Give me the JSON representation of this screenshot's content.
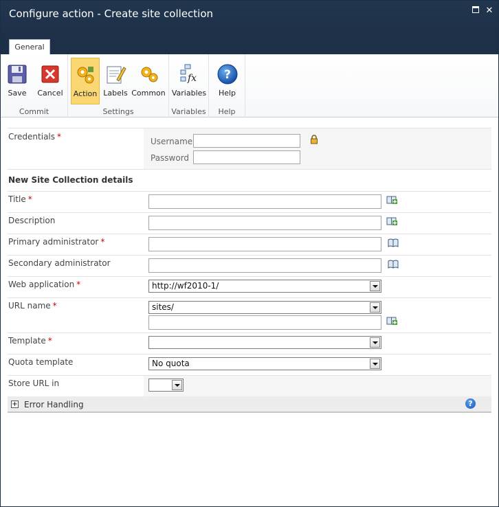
{
  "window": {
    "title": "Configure action - Create site collection"
  },
  "ribbon": {
    "tab": "General",
    "groups": {
      "commit": "Commit",
      "settings": "Settings",
      "variables": "Variables",
      "help": "Help"
    },
    "buttons": {
      "save": "Save",
      "cancel": "Cancel",
      "action": "Action",
      "labels": "Labels",
      "common": "Common",
      "variables": "Variables",
      "help": "Help"
    }
  },
  "form": {
    "credentials": {
      "label": "Credentials",
      "username_label": "Username",
      "password_label": "Password",
      "username_value": "",
      "password_value": ""
    },
    "section_title": "New Site Collection details",
    "title": {
      "label": "Title",
      "value": ""
    },
    "description": {
      "label": "Description",
      "value": ""
    },
    "primary_admin": {
      "label": "Primary administrator",
      "value": ""
    },
    "secondary_admin": {
      "label": "Secondary administrator",
      "value": ""
    },
    "web_application": {
      "label": "Web application",
      "selected": "http://wf2010-1/"
    },
    "url_name": {
      "label": "URL name",
      "selected": "sites/",
      "value": ""
    },
    "template": {
      "label": "Template",
      "selected": ""
    },
    "quota_template": {
      "label": "Quota template",
      "selected": "No quota"
    },
    "store_url": {
      "label": "Store URL in",
      "selected": ""
    },
    "required_marker": "*"
  },
  "error_handling": {
    "label": "Error Handling",
    "expand": "+"
  },
  "colors": {
    "titlebar": "#1d3048",
    "active_button": "#fbd773",
    "required": "#cc0000"
  }
}
